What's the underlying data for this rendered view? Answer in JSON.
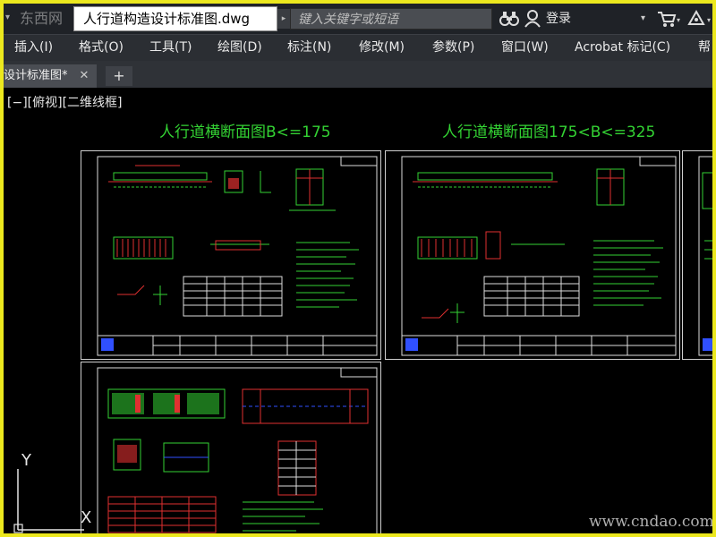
{
  "window": {
    "quick_access_glyph": "▾",
    "logo_text": "东西网",
    "document_title": "人行道构造设计标准图.dwg"
  },
  "search": {
    "arrow_glyph": "▸",
    "placeholder": "键入关键字或短语"
  },
  "account": {
    "login_label": "登录",
    "login_dropdown": "▾",
    "cart_dropdown": "▾",
    "help_dropdown": "▾"
  },
  "menu": {
    "items": [
      "插入(I)",
      "格式(O)",
      "工具(T)",
      "绘图(D)",
      "标注(N)",
      "修改(M)",
      "参数(P)",
      "窗口(W)",
      "Acrobat 标记(C)",
      "帮"
    ]
  },
  "tabs": {
    "active_label": "设计标准图*",
    "close_glyph": "✕",
    "new_tab_glyph": "+"
  },
  "viewport": {
    "label": "[−][俯视][二维线框]"
  },
  "drawing": {
    "sheet1_title": "人行道横断面图B<=175",
    "sheet2_title": "人行道横断面图175<B<=325"
  },
  "ucs": {
    "y_label": "Y",
    "x_label": "X"
  },
  "watermark": "www.cndao.com",
  "colors": {
    "highlight_border": "#ece81e",
    "canvas_background": "#000000",
    "drawing_green": "#33d233",
    "drawing_red": "#e03030",
    "title_block_blue": "#3050ff"
  }
}
